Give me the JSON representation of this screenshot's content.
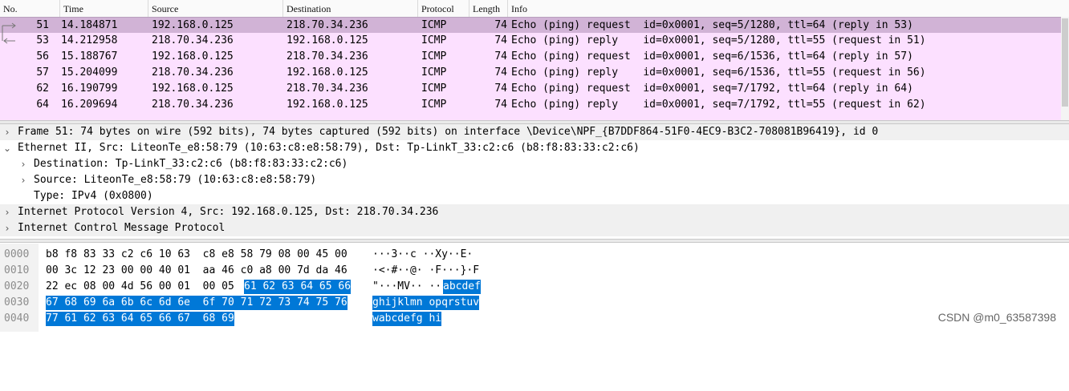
{
  "packet_list": {
    "columns": [
      "No.",
      "Time",
      "Source",
      "Destination",
      "Protocol",
      "Length",
      "Info"
    ],
    "rows": [
      {
        "no": "51",
        "time": "14.184871",
        "src": "192.168.0.125",
        "dst": "218.70.34.236",
        "proto": "ICMP",
        "len": "74",
        "info": "Echo (ping) request  id=0x0001, seq=5/1280, ttl=64 (reply in 53)",
        "selected": true
      },
      {
        "no": "53",
        "time": "14.212958",
        "src": "218.70.34.236",
        "dst": "192.168.0.125",
        "proto": "ICMP",
        "len": "74",
        "info": "Echo (ping) reply    id=0x0001, seq=5/1280, ttl=55 (request in 51)"
      },
      {
        "no": "56",
        "time": "15.188767",
        "src": "192.168.0.125",
        "dst": "218.70.34.236",
        "proto": "ICMP",
        "len": "74",
        "info": "Echo (ping) request  id=0x0001, seq=6/1536, ttl=64 (reply in 57)"
      },
      {
        "no": "57",
        "time": "15.204099",
        "src": "218.70.34.236",
        "dst": "192.168.0.125",
        "proto": "ICMP",
        "len": "74",
        "info": "Echo (ping) reply    id=0x0001, seq=6/1536, ttl=55 (request in 56)"
      },
      {
        "no": "62",
        "time": "16.190799",
        "src": "192.168.0.125",
        "dst": "218.70.34.236",
        "proto": "ICMP",
        "len": "74",
        "info": "Echo (ping) request  id=0x0001, seq=7/1792, ttl=64 (reply in 64)"
      },
      {
        "no": "64",
        "time": "16.209694",
        "src": "218.70.34.236",
        "dst": "192.168.0.125",
        "proto": "ICMP",
        "len": "74",
        "info": "Echo (ping) reply    id=0x0001, seq=7/1792, ttl=55 (request in 62)"
      }
    ],
    "row_color": "#fce0ff",
    "selected_color": "#d1b3d6"
  },
  "details": {
    "rows": [
      {
        "text": "Frame 51: 74 bytes on wire (592 bits), 74 bytes captured (592 bits) on interface \\Device\\NPF_{B7DDF864-51F0-4EC9-B3C2-708081B96419}, id 0",
        "expander": "collapsed"
      },
      {
        "text": "Ethernet II, Src: LiteonTe_e8:58:79 (10:63:c8:e8:58:79), Dst: Tp-LinkT_33:c2:c6 (b8:f8:83:33:c2:c6)",
        "expander": "expanded"
      },
      {
        "text": "Destination: Tp-LinkT_33:c2:c6 (b8:f8:83:33:c2:c6)",
        "expander": "collapsed"
      },
      {
        "text": "Source: LiteonTe_e8:58:79 (10:63:c8:e8:58:79)",
        "expander": "collapsed"
      },
      {
        "text": "Type: IPv4 (0x0800)",
        "expander": "none"
      },
      {
        "text": "Internet Protocol Version 4, Src: 192.168.0.125, Dst: 218.70.34.236",
        "expander": "collapsed"
      },
      {
        "text": "Internet Control Message Protocol",
        "expander": "collapsed"
      }
    ]
  },
  "bytes": {
    "rows": [
      {
        "offset": "0000",
        "hex_plain": "b8 f8 83 33 c2 c6 10 63  c8 e8 58 79 08 00 45 00",
        "hex_hl": "",
        "ascii_plain": "···3··c ··Xy··E·",
        "ascii_hl": ""
      },
      {
        "offset": "0010",
        "hex_plain": "00 3c 12 23 00 00 40 01  aa 46 c0 a8 00 7d da 46",
        "hex_hl": "",
        "ascii_plain": "·<·#··@· ·F···}·F",
        "ascii_hl": ""
      },
      {
        "offset": "0020",
        "hex_plain": "22 ec 08 00 4d 56 00 01  00 05 ",
        "hex_hl": "61 62 63 64 65 66",
        "ascii_plain": "\"···MV·· ··",
        "ascii_hl": "abcdef"
      },
      {
        "offset": "0030",
        "hex_plain": "",
        "hex_hl": "67 68 69 6a 6b 6c 6d 6e  6f 70 71 72 73 74 75 76",
        "ascii_plain": "",
        "ascii_hl": "ghijklmn opqrstuv"
      },
      {
        "offset": "0040",
        "hex_plain": "",
        "hex_hl": "77 61 62 63 64 65 66 67  68 69",
        "ascii_plain": "",
        "ascii_hl": "wabcdefg hi"
      }
    ],
    "highlight_color": "#0078d7"
  },
  "watermark": "CSDN @m0_63587398"
}
